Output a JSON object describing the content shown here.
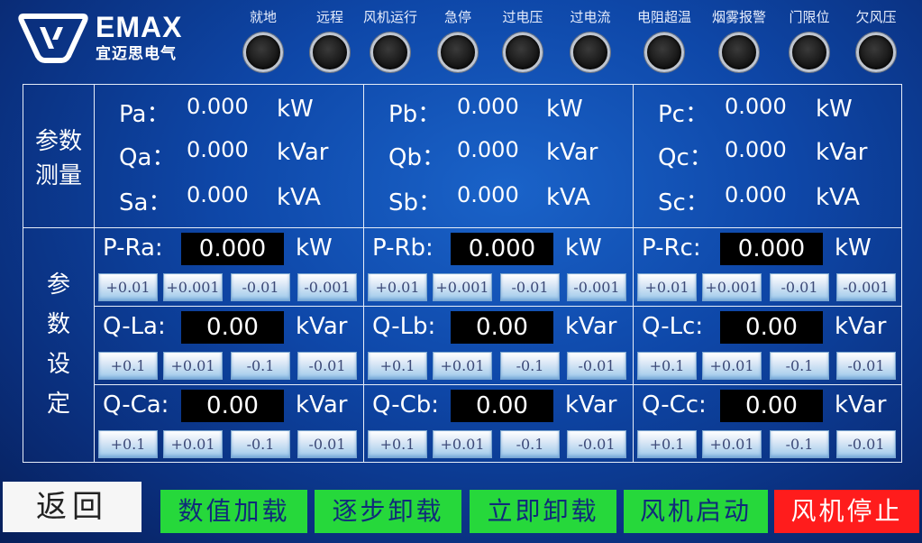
{
  "brand": {
    "name": "EMAX",
    "subtitle": "宜迈思电气"
  },
  "indicators": [
    {
      "label": "就地"
    },
    {
      "label": "远程"
    },
    {
      "label": "风机运行"
    },
    {
      "label": "急停"
    },
    {
      "label": "过电压"
    },
    {
      "label": "过电流"
    },
    {
      "label": "电阻超温"
    },
    {
      "label": "烟雾报警"
    },
    {
      "label": "门限位"
    },
    {
      "label": "欠风压"
    }
  ],
  "measure": {
    "section_label_1": "参数",
    "section_label_2": "测量",
    "phases": [
      {
        "rows": [
          {
            "name": "Pa：",
            "value": "0.000",
            "unit": "kW"
          },
          {
            "name": "Qa：",
            "value": "0.000",
            "unit": "kVar"
          },
          {
            "name": "Sa：",
            "value": "0.000",
            "unit": "kVA"
          }
        ]
      },
      {
        "rows": [
          {
            "name": "Pb：",
            "value": "0.000",
            "unit": "kW"
          },
          {
            "name": "Qb：",
            "value": "0.000",
            "unit": "kVar"
          },
          {
            "name": "Sb：",
            "value": "0.000",
            "unit": "kVA"
          }
        ]
      },
      {
        "rows": [
          {
            "name": "Pc：",
            "value": "0.000",
            "unit": "kW"
          },
          {
            "name": "Qc：",
            "value": "0.000",
            "unit": "kVar"
          },
          {
            "name": "Sc：",
            "value": "0.000",
            "unit": "kVA"
          }
        ]
      }
    ]
  },
  "setting": {
    "section_label": [
      "参",
      "数",
      "设",
      "定"
    ],
    "rows": [
      {
        "cells": [
          {
            "name": "P-Ra:",
            "value": "0.000",
            "unit": "kW",
            "steps": [
              "+0.01",
              "+0.001",
              "-0.01",
              "-0.001"
            ]
          },
          {
            "name": "P-Rb:",
            "value": "0.000",
            "unit": "kW",
            "steps": [
              "+0.01",
              "+0.001",
              "-0.01",
              "-0.001"
            ]
          },
          {
            "name": "P-Rc:",
            "value": "0.000",
            "unit": "kW",
            "steps": [
              "+0.01",
              "+0.001",
              "-0.01",
              "-0.001"
            ]
          }
        ]
      },
      {
        "cells": [
          {
            "name": "Q-La:",
            "value": "0.00",
            "unit": "kVar",
            "steps": [
              "+0.1",
              "+0.01",
              "-0.1",
              "-0.01"
            ]
          },
          {
            "name": "Q-Lb:",
            "value": "0.00",
            "unit": "kVar",
            "steps": [
              "+0.1",
              "+0.01",
              "-0.1",
              "-0.01"
            ]
          },
          {
            "name": "Q-Lc:",
            "value": "0.00",
            "unit": "kVar",
            "steps": [
              "+0.1",
              "+0.01",
              "-0.1",
              "-0.01"
            ]
          }
        ]
      },
      {
        "cells": [
          {
            "name": "Q-Ca:",
            "value": "0.00",
            "unit": "kVar",
            "steps": [
              "+0.1",
              "+0.01",
              "-0.1",
              "-0.01"
            ]
          },
          {
            "name": "Q-Cb:",
            "value": "0.00",
            "unit": "kVar",
            "steps": [
              "+0.1",
              "+0.01",
              "-0.1",
              "-0.01"
            ]
          },
          {
            "name": "Q-Cc:",
            "value": "0.00",
            "unit": "kVar",
            "steps": [
              "+0.1",
              "+0.01",
              "-0.1",
              "-0.01"
            ]
          }
        ]
      }
    ]
  },
  "buttons": {
    "back": "返回",
    "load": "数值加载",
    "step_unload": "逐步卸载",
    "immediate_unload": "立即卸载",
    "fan_start": "风机启动",
    "fan_stop": "风机停止"
  },
  "colors": {
    "background": "#0e47a8",
    "green_button": "#26d83b",
    "red_button": "#ff1c1c",
    "value_box": "#000000"
  }
}
